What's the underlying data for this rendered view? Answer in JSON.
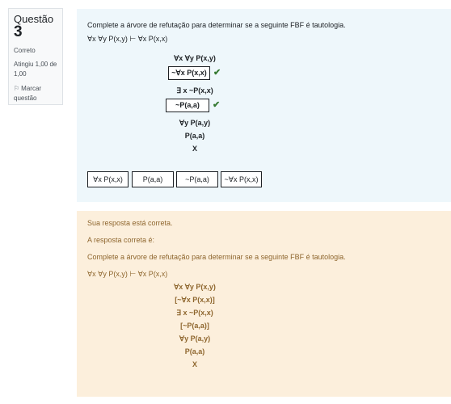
{
  "info": {
    "question_label": "Questão",
    "question_number": "3",
    "state": "Correto",
    "grade": "Atingiu 1,00 de 1,00",
    "flag_icon": "flag-icon",
    "flag_label": "Marcar questão"
  },
  "question": {
    "prompt": "Complete a árvore de refutação para determinar se a seguinte FBF é tautologia.",
    "premise": "∀x ∀y P(x,y) ⊢ ∀x P(x,x)",
    "tree": {
      "node1": "∀x ∀y P(x,y)",
      "drop1": "~∀x P(x,x)",
      "node3": "∃ x ~P(x,x)",
      "drop2": "~P(a,a)",
      "node5": "∀y P(a,y)",
      "node6": "P(a,a)",
      "node7": "X"
    },
    "check_icon": "check-icon",
    "choices": [
      "∀x P(x,x)",
      "P(a,a)",
      "~P(a,a)",
      "~∀x P(x,x)"
    ]
  },
  "feedback": {
    "correct_msg": "Sua resposta está correta.",
    "answer_label": "A resposta correta é:",
    "prompt": "Complete a árvore de refutação para determinar se a seguinte FBF é tautologia.",
    "premise": "∀x ∀y P(x,y) ⊢ ∀x P(x,x)",
    "tree": [
      "∀x ∀y P(x,y)",
      "[~∀x P(x,x)]",
      "∃ x ~P(x,x)",
      "[~P(a,a)]",
      "∀y P(a,y)",
      "P(a,a)",
      "X"
    ]
  },
  "colors": {
    "info_bg": "#f8f9fa",
    "formulation_bg": "#eef7fb",
    "feedback_bg": "#fcefdc",
    "feedback_text": "#8e662e",
    "check": "#357a32"
  }
}
